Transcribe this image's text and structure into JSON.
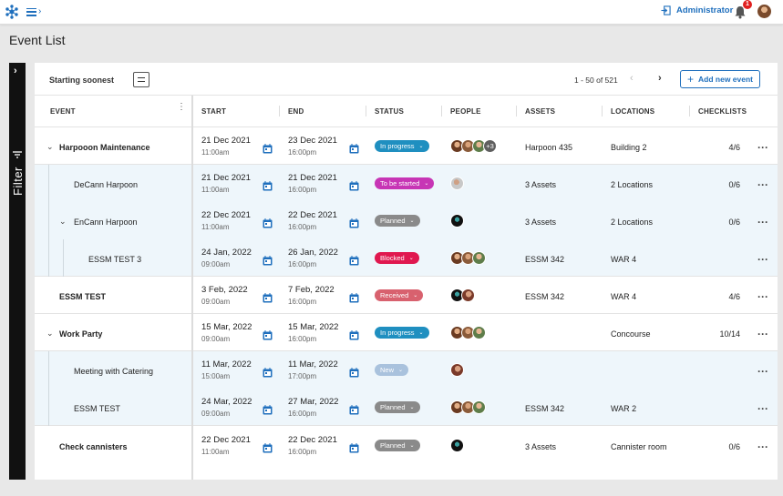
{
  "topbar": {
    "logo_icon": "network-logo-icon",
    "menu_icon": "hamburger-chevron-icon",
    "admin_label": "Administrator",
    "notification_count": "1",
    "accent": "#1f6fbd"
  },
  "page": {
    "title": "Event List"
  },
  "filter": {
    "label": "Filter",
    "chevron": "›"
  },
  "toolbar": {
    "sort_label": "Starting soonest",
    "pagination": "1 - 50 of 521",
    "prev": "‹",
    "next": "›",
    "add_plus": "+",
    "add_label": "Add new event"
  },
  "columns": {
    "event": "EVENT",
    "start": "START",
    "end": "END",
    "status": "STATUS",
    "people": "PEOPLE",
    "assets": "ASSETS",
    "locations": "LOCATIONS",
    "checklists": "CHECKLISTS"
  },
  "status_colors": {
    "In progress": "#1f8fc0",
    "To be started": "#c735b5",
    "Planned": "#8a8a8a",
    "Blocked": "#e0184f",
    "Received": "#d8616e",
    "New": "#a9c2dd"
  },
  "rows": [
    {
      "toggle": "⌄",
      "name": "Harpooon Maintenance",
      "start_date": "21 Dec 2021",
      "start_time": "11:00am",
      "end_date": "23 Dec 2021",
      "end_time": "16:00pm",
      "status": "In progress",
      "caret": "⌄",
      "more_people": "+3",
      "assets": "Harpoon 435",
      "locations": "Building 2",
      "checklists": "4/6",
      "kebab": "···"
    },
    {
      "name": "DeCann Harpoon",
      "start_date": "21 Dec 2021",
      "start_time": "11:00am",
      "end_date": "21 Dec 2021",
      "end_time": "16:00pm",
      "status": "To be started",
      "caret": "⌄",
      "assets": "3 Assets",
      "locations": "2 Locations",
      "checklists": "0/6",
      "kebab": "···"
    },
    {
      "toggle": "⌄",
      "name": "EnCann Harpoon",
      "start_date": "22 Dec 2021",
      "start_time": "11:00am",
      "end_date": "22 Dec 2021",
      "end_time": "16:00pm",
      "status": "Planned",
      "caret": "⌄",
      "assets": "3 Assets",
      "locations": "2 Locations",
      "checklists": "0/6",
      "kebab": "···"
    },
    {
      "name": "ESSM TEST 3",
      "start_date": "24 Jan, 2022",
      "start_time": "09:00am",
      "end_date": "26 Jan, 2022",
      "end_time": "16:00pm",
      "status": "Blocked",
      "caret": "⌄",
      "assets": "ESSM 342",
      "locations": "WAR 4",
      "checklists": "",
      "kebab": "···"
    },
    {
      "name": "ESSM TEST",
      "start_date": "3 Feb, 2022",
      "start_time": "09:00am",
      "end_date": "7 Feb, 2022",
      "end_time": "16:00pm",
      "status": "Received",
      "caret": "⌄",
      "assets": "ESSM 342",
      "locations": "WAR 4",
      "checklists": "4/6",
      "kebab": "···"
    },
    {
      "toggle": "⌄",
      "name": "Work Party",
      "start_date": "15 Mar, 2022",
      "start_time": "09:00am",
      "end_date": "15 Mar, 2022",
      "end_time": "16:00pm",
      "status": "In progress",
      "caret": "⌄",
      "assets": "",
      "locations": "Concourse",
      "checklists": "10/14",
      "kebab": "···"
    },
    {
      "name": "Meeting with  Catering",
      "start_date": "11 Mar, 2022",
      "start_time": "15:00am",
      "end_date": "11 Mar, 2022",
      "end_time": "17:00pm",
      "status": "New",
      "caret": "⌄",
      "assets": "",
      "locations": "",
      "checklists": "",
      "kebab": "···"
    },
    {
      "name": "ESSM TEST",
      "start_date": "24 Mar, 2022",
      "start_time": "09:00am",
      "end_date": "27 Mar, 2022",
      "end_time": "16:00pm",
      "status": "Planned",
      "caret": "⌄",
      "assets": "ESSM 342",
      "locations": "WAR 2",
      "checklists": "",
      "kebab": "···"
    },
    {
      "name": "Check cannisters",
      "start_date": "22 Dec 2021",
      "start_time": "11:00am",
      "end_date": "22 Dec 2021",
      "end_time": "16:00pm",
      "status": "Planned",
      "caret": "⌄",
      "assets": "3 Assets",
      "locations": "Cannister room",
      "checklists": "0/6",
      "kebab": "···"
    }
  ]
}
